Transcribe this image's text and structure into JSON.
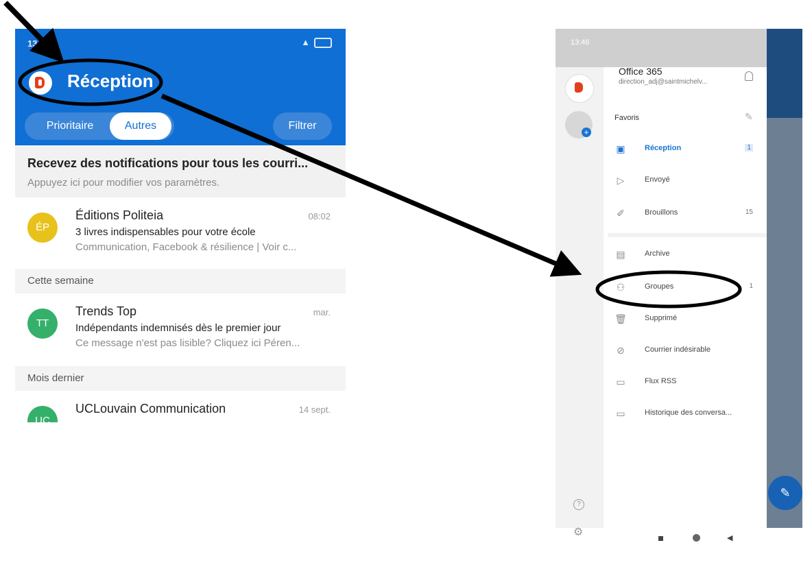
{
  "left": {
    "status_time": "13",
    "header_title": "Réception",
    "tabs": [
      "Prioritaire",
      "Autres"
    ],
    "filter": "Filtrer",
    "notification": {
      "title": "Recevez des notifications pour tous les courri...",
      "subtitle": "Appuyez ici pour modifier vos paramètres."
    },
    "emails": [
      {
        "initials": "ÉP",
        "color": "#e8c21a",
        "sender": "Éditions Politeia",
        "date": "08:02",
        "subject": "3 livres indispensables pour votre école",
        "preview": "Communication, Facebook & résilience | Voir c..."
      },
      {
        "initials": "TT",
        "color": "#35b06b",
        "sender": "Trends Top",
        "date": "mar.",
        "subject": "Indépendants indemnisés dès le premier jour",
        "preview": "Ce message n'est pas lisible? Cliquez ici Péren..."
      },
      {
        "initials": "UC",
        "color": "#35b06b",
        "sender": "UCLouvain Communication",
        "date": "14 sept."
      }
    ],
    "sections": [
      "Cette semaine",
      "Mois dernier"
    ]
  },
  "right": {
    "status_time": "13:46",
    "account_name": "Office 365",
    "account_email": "direction_adj@saintmichelv...",
    "favorites": "Favoris",
    "fav_items": [
      {
        "label": "Réception",
        "count": "1",
        "icon": "inbox-icon"
      },
      {
        "label": "Envoyé",
        "count": "",
        "icon": "send-icon"
      },
      {
        "label": "Brouillons",
        "count": "15",
        "icon": "draft-icon"
      }
    ],
    "folders": [
      {
        "label": "Archive",
        "count": "",
        "icon": "archive-icon"
      },
      {
        "label": "Groupes",
        "count": "1",
        "icon": "groups-icon"
      },
      {
        "label": "Supprimé",
        "count": "",
        "icon": "trash-icon"
      },
      {
        "label": "Courrier indésirable",
        "count": "",
        "icon": "junk-icon"
      },
      {
        "label": "Flux RSS",
        "count": "",
        "icon": "folder-icon"
      },
      {
        "label": "Historique des conversa...",
        "count": "",
        "icon": "folder-icon"
      }
    ]
  },
  "colors": {
    "brand_blue": "#0f6fd4",
    "annotation": "#000000",
    "office_red": "#e2401c"
  }
}
